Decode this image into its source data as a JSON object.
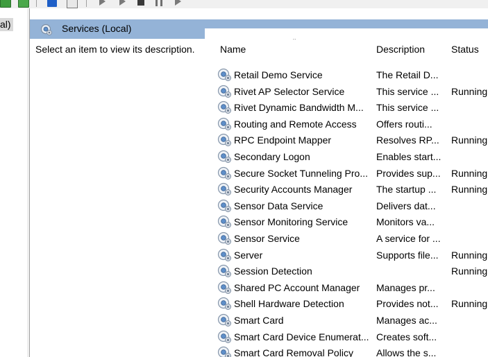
{
  "tree": {
    "selected_label_fragment": "al)"
  },
  "pane": {
    "title": "Services (Local)",
    "description_prompt": "Select an item to view its description."
  },
  "columns": {
    "name": "Name",
    "description": "Description",
    "status": "Status"
  },
  "services": [
    {
      "name": "Retail Demo Service",
      "description": "The Retail D...",
      "status": ""
    },
    {
      "name": "Rivet AP Selector Service",
      "description": "This service ...",
      "status": "Running"
    },
    {
      "name": "Rivet Dynamic Bandwidth M...",
      "description": "This service ...",
      "status": ""
    },
    {
      "name": "Routing and Remote Access",
      "description": "Offers routi...",
      "status": ""
    },
    {
      "name": "RPC Endpoint Mapper",
      "description": "Resolves RP...",
      "status": "Running"
    },
    {
      "name": "Secondary Logon",
      "description": "Enables start...",
      "status": ""
    },
    {
      "name": "Secure Socket Tunneling Pro...",
      "description": "Provides sup...",
      "status": "Running"
    },
    {
      "name": "Security Accounts Manager",
      "description": "The startup ...",
      "status": "Running"
    },
    {
      "name": "Sensor Data Service",
      "description": "Delivers dat...",
      "status": ""
    },
    {
      "name": "Sensor Monitoring Service",
      "description": "Monitors va...",
      "status": ""
    },
    {
      "name": "Sensor Service",
      "description": "A service for ...",
      "status": ""
    },
    {
      "name": "Server",
      "description": "Supports file...",
      "status": "Running"
    },
    {
      "name": "Session Detection",
      "description": "",
      "status": "Running"
    },
    {
      "name": "Shared PC Account Manager",
      "description": "Manages pr...",
      "status": ""
    },
    {
      "name": "Shell Hardware Detection",
      "description": "Provides not...",
      "status": "Running"
    },
    {
      "name": "Smart Card",
      "description": "Manages ac...",
      "status": ""
    },
    {
      "name": "Smart Card Device Enumerat...",
      "description": "Creates soft...",
      "status": ""
    },
    {
      "name": "Smart Card Removal Policy",
      "description": "Allows the s...",
      "status": ""
    }
  ],
  "icons": {
    "toolbar": [
      "refresh-icon",
      "export-list-icon",
      "help-icon",
      "show-hide-action-pane-icon",
      "start-service-icon",
      "start-service-alt-icon",
      "stop-service-icon",
      "pause-service-icon",
      "restart-service-icon"
    ],
    "service": "service-gear-icon"
  },
  "colors": {
    "pane_header": "#94b3d7",
    "selection": "#d9d9d9"
  }
}
